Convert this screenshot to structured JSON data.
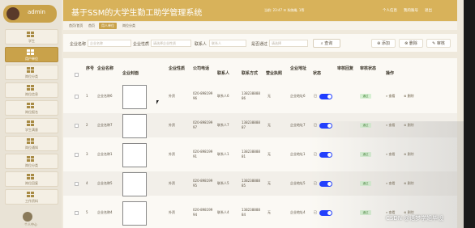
{
  "user": {
    "name": "admin"
  },
  "sidebar": {
    "items": [
      {
        "label": "学生",
        "active": false
      },
      {
        "label": "用户单位",
        "active": true
      },
      {
        "label": "岗位分类",
        "active": false
      },
      {
        "label": "岗位信息",
        "active": false
      },
      {
        "label": "岗位报名",
        "active": false
      },
      {
        "label": "学生满意",
        "active": false
      },
      {
        "label": "岗位通知",
        "active": false
      },
      {
        "label": "岗位分类",
        "active": false
      },
      {
        "label": "岗位回复",
        "active": false
      },
      {
        "label": "工作资料",
        "active": false
      }
    ],
    "bottom_label": "个人中心"
  },
  "header": {
    "title": "基于SSM的大学生勤工助学管理系统",
    "info": "当前: 23:47  ☰ 系统端, 1等",
    "links": [
      "个人信息",
      "我的账号",
      "退出"
    ]
  },
  "breadcrumb": [
    "首页/首页",
    "首页",
    "用人单位",
    "岗位分类"
  ],
  "search": {
    "fields": [
      {
        "label": "企业名称",
        "placeholder": "企业名称"
      },
      {
        "label": "企业性质",
        "placeholder": "请选择企业性质"
      },
      {
        "label": "联系人",
        "placeholder": "联系人"
      },
      {
        "label": "是否通过",
        "placeholder": "请选择"
      }
    ],
    "button": "查询",
    "actions": [
      "添加",
      "删除",
      "审核"
    ]
  },
  "table": {
    "columns": [
      "序号",
      "企业名称",
      "企业封面",
      "企业性质",
      "公司电话",
      "联系人",
      "联系方式",
      "营业执照",
      "企业地址",
      "状态",
      "审核回复",
      "审核状态",
      "操作"
    ],
    "rows": [
      {
        "index": "1",
        "name": "企业名称6",
        "nature": "外资",
        "phone": "020-89819996",
        "contact": "联系人6",
        "mobile": "13823888886",
        "license": "无",
        "address": "企业地址6",
        "status": "已",
        "audit": "通过",
        "ops": [
          "查看",
          "删除"
        ]
      },
      {
        "index": "2",
        "name": "企业名称7",
        "nature": "外资",
        "phone": "020-89819997",
        "contact": "联系人7",
        "mobile": "13823888887",
        "license": "无",
        "address": "企业地址7",
        "status": "已",
        "audit": "通过",
        "ops": [
          "查看",
          "删除"
        ]
      },
      {
        "index": "3",
        "name": "企业名称1",
        "nature": "外资",
        "phone": "020-89819991",
        "contact": "联系人1",
        "mobile": "13823888881",
        "license": "无",
        "address": "企业地址1",
        "status": "已",
        "audit": "通过",
        "ops": [
          "查看",
          "删除"
        ]
      },
      {
        "index": "4",
        "name": "企业名称5",
        "nature": "外资",
        "phone": "020-89819995",
        "contact": "联系人5",
        "mobile": "13823888885",
        "license": "无",
        "address": "企业地址5",
        "status": "已",
        "audit": "通过",
        "ops": [
          "查看",
          "删除"
        ]
      },
      {
        "index": "5",
        "name": "企业名称4",
        "nature": "外资",
        "phone": "020-89819994",
        "contact": "联系人4",
        "mobile": "13823888884",
        "license": "无",
        "address": "企业地址4",
        "status": "已",
        "audit": "通过",
        "ops": [
          "查看",
          "删除"
        ]
      }
    ]
  },
  "watermark": "CSDN @语梦学姐毕设",
  "colors": {
    "accent": "#d8b25a",
    "toggle": "#1e3cff",
    "badge": "#d6f0d2"
  }
}
